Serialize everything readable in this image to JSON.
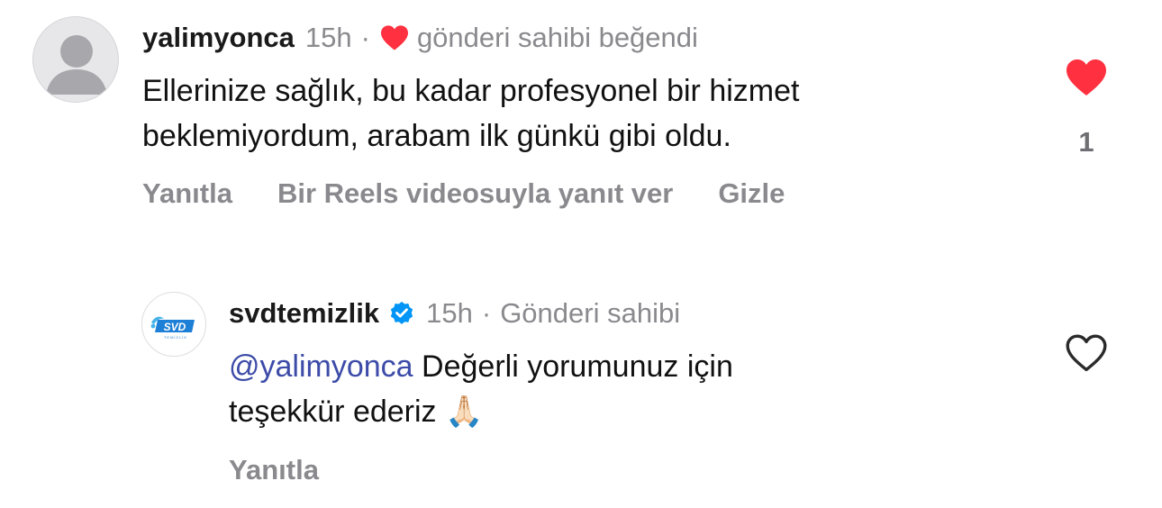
{
  "comments": [
    {
      "username": "yalimyonca",
      "time": "15h",
      "separator": "·",
      "liked_by_owner": "gönderi sahibi beğendi",
      "text_line1": "Ellerinize sağlık, bu kadar profesyonel bir hizmet",
      "text_line2": "beklemiyordum, arabam ilk günkü gibi oldu.",
      "like_count": "1",
      "actions": {
        "reply": "Yanıtla",
        "reels_reply": "Bir Reels videosuyla yanıt ver",
        "hide": "Gizle"
      }
    },
    {
      "username": "svdtemizlik",
      "verified": true,
      "time": "15h",
      "separator": "·",
      "owner_label": "Gönderi sahibi",
      "mention": "@yalimyonca",
      "text_line1": " Değerli yorumunuz için",
      "text_line2": "teşekkür ederiz",
      "emoji": "🙏🏻",
      "logo_text": "SVD",
      "logo_subtext": "TEMİZLİK",
      "actions": {
        "reply": "Yanıtla"
      }
    }
  ],
  "colors": {
    "like_red": "#ff3040",
    "verified_blue": "#0095f6",
    "mention_blue": "#3c4ba8",
    "muted_gray": "#8a8a8e",
    "brand_blue": "#1e7fd6"
  }
}
